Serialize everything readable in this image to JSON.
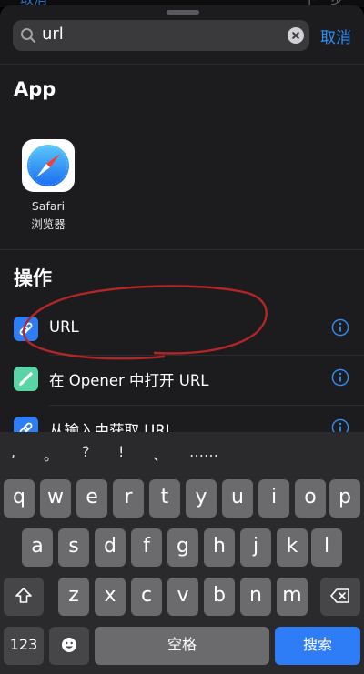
{
  "peek": {
    "left": "取消",
    "right": "下一步"
  },
  "search": {
    "query": "url",
    "cancel": "取消"
  },
  "apps_section": {
    "title": "App",
    "apps": [
      {
        "name": "Safari\n浏览器"
      }
    ]
  },
  "actions_section": {
    "title": "操作",
    "items": [
      {
        "label": "URL",
        "icon_color": "#2f7df6"
      },
      {
        "label": "在 Opener 中打开 URL",
        "icon_color": "#5ad3a6"
      },
      {
        "label": "从输入中获取 URL",
        "icon_color": "#2f7df6"
      }
    ]
  },
  "annotation": {
    "color": "#b32626"
  },
  "keyboard": {
    "candidates": [
      ",",
      "。",
      "?",
      "!",
      "、",
      "……"
    ],
    "row1": [
      "q",
      "w",
      "e",
      "r",
      "t",
      "y",
      "u",
      "i",
      "o",
      "p"
    ],
    "row2": [
      "a",
      "s",
      "d",
      "f",
      "g",
      "h",
      "j",
      "k",
      "l"
    ],
    "row3": [
      "z",
      "x",
      "c",
      "v",
      "b",
      "n",
      "m"
    ],
    "num_key": "123",
    "space_key": "空格",
    "search_key": "搜索"
  }
}
